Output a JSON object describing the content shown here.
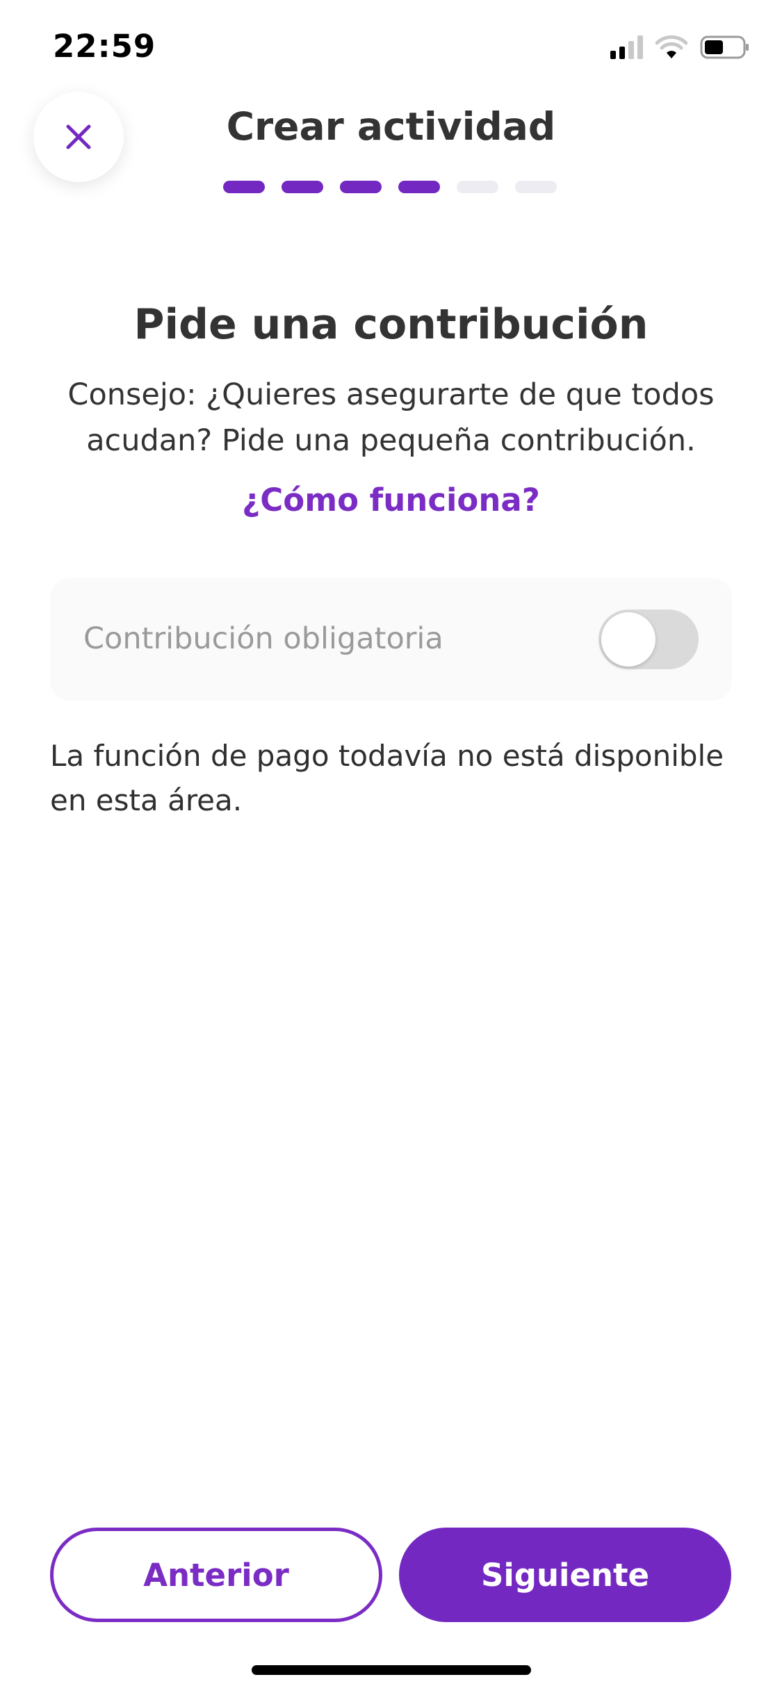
{
  "status_bar": {
    "time": "22:59",
    "icons": [
      "signal-icon",
      "wifi-icon",
      "battery-icon"
    ]
  },
  "header": {
    "title": "Crear actividad",
    "close_icon": "close-icon",
    "progress_total_steps": 6,
    "progress_completed_steps": 4
  },
  "section": {
    "title": "Pide una contribución",
    "description": "Consejo: ¿Quieres asegurarte de que todos acudan? Pide una pequeña contribución.",
    "link": "¿Cómo funciona?"
  },
  "contribution": {
    "label": "Contribución obligatoria",
    "enabled": false
  },
  "note": "La función de pago todavía no está disponible en esta área.",
  "footer": {
    "prev_label": "Anterior",
    "next_label": "Siguiente"
  },
  "colors": {
    "accent": "#7328c2",
    "accent_text": "#7a2cc4",
    "progress_inactive": "#ececf2",
    "toggle_off": "#dadada"
  }
}
